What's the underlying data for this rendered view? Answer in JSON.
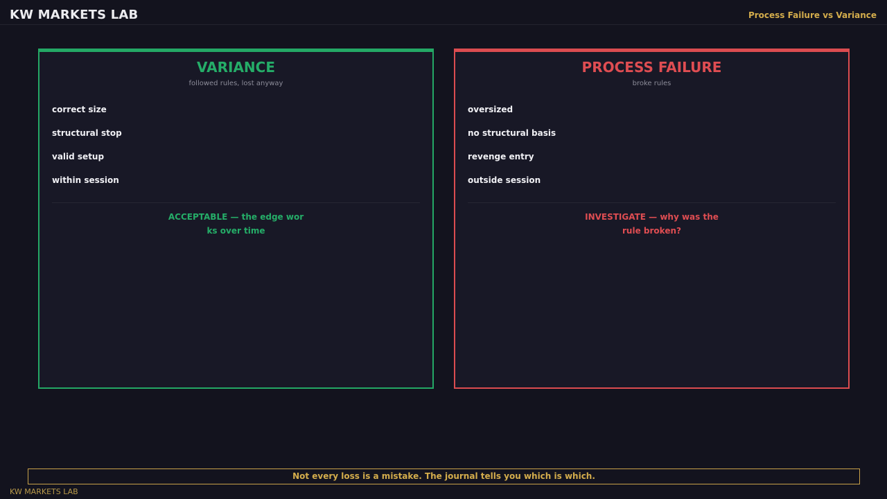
{
  "header": {
    "brand": "KW MARKETS LAB",
    "topic": "Process Failure vs Variance"
  },
  "panels": {
    "variance": {
      "title": "VARIANCE",
      "subtitle": "followed rules, lost anyway",
      "items": [
        "correct size",
        "structural stop",
        "valid setup",
        "within session"
      ],
      "verdict": "ACCEPTABLE — the edge works over time",
      "accent_color": "#24a865"
    },
    "failure": {
      "title": "PROCESS FAILURE",
      "subtitle": "broke rules",
      "items": [
        "oversized",
        "no structural basis",
        "revenge entry",
        "outside session"
      ],
      "verdict": "INVESTIGATE — why was the rule broken?",
      "accent_color": "#db4c50"
    }
  },
  "footer": {
    "note": "Not every loss is a mistake. The journal tells you which is which.",
    "brand": "KW MARKETS LAB",
    "accent_color": "#d4ad4c"
  }
}
